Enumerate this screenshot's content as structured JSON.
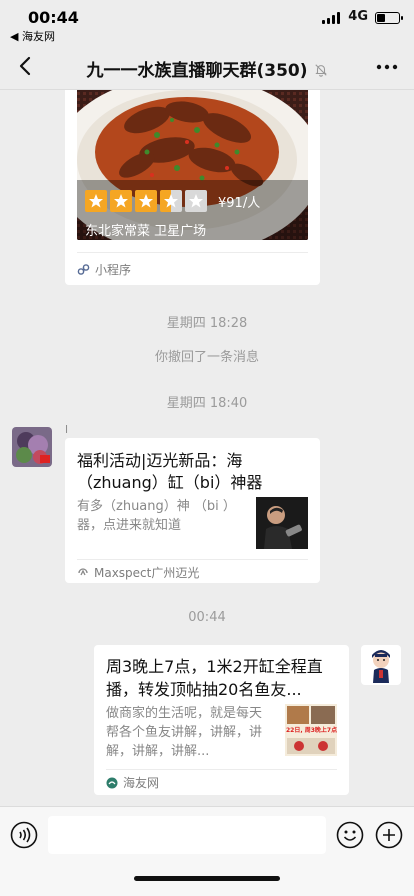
{
  "status_bar": {
    "time": "00:44",
    "back_app": "◀ 海友网",
    "network": "4G",
    "battery_fraction": 0.35
  },
  "nav": {
    "title": "九一一水族直播聊天群(350)",
    "back_icon": "chevron-left-icon",
    "mute_icon": "bell-off-icon",
    "more_icon": "more-dots-icon"
  },
  "mini_program_card": {
    "rating_stars": 3.5,
    "rating_max": 5,
    "price": "¥91/人",
    "label": "东北家常菜  卫星广场",
    "footer": "小程序"
  },
  "system_messages": {
    "time1": "星期四 18:28",
    "recalled": "你撤回了一条消息",
    "time2": "星期四 18:40",
    "time3": "00:44"
  },
  "message1": {
    "sender": "l",
    "title": "福利活动|迈光新品：海（zhuang）缸（bi）神器",
    "desc": "有多（zhuang）神 （bi ）器，点进来就知道",
    "source": "Maxspect广州迈光"
  },
  "message2": {
    "title": "周3晚上7点，1米2开缸全程直播，转发顶帖抽20名鱼友...",
    "desc": "做商家的生活呢，就是每天帮各个鱼友讲解，讲解，讲解，讲解，讲解...",
    "thumb_caption": "22日, 周3晚上7点",
    "source": "海友网"
  },
  "input_bar": {
    "voice_icon": "voice-icon",
    "emoji_icon": "emoji-icon",
    "plus_icon": "plus-icon"
  },
  "colors": {
    "background": "#ededed",
    "star": "#f5a623",
    "meta_text": "#9b9b9b"
  }
}
